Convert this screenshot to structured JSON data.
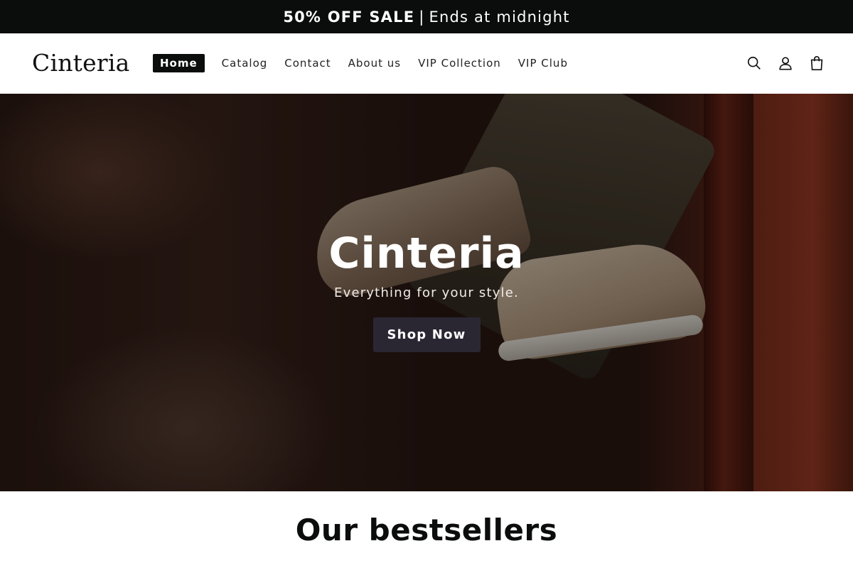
{
  "announcement": {
    "bold_text": "50% OFF SALE",
    "separator": "|",
    "rest_text": "Ends at midnight"
  },
  "header": {
    "logo": "Cinteria",
    "nav": [
      {
        "label": "Home",
        "active": true
      },
      {
        "label": "Catalog",
        "active": false
      },
      {
        "label": "Contact",
        "active": false
      },
      {
        "label": "About us",
        "active": false
      },
      {
        "label": "VIP Collection",
        "active": false
      },
      {
        "label": "VIP Club",
        "active": false
      }
    ],
    "icons": [
      "search-icon",
      "account-icon",
      "cart-icon"
    ]
  },
  "hero": {
    "title": "Cinteria",
    "subtitle": "Everything for your style.",
    "button_label": "Shop Now"
  },
  "section": {
    "title": "Our bestsellers"
  },
  "colors": {
    "announcement_bg": "#0b0c0c",
    "button_bg": "#2a2733",
    "text_dark": "#0b0c0c"
  }
}
